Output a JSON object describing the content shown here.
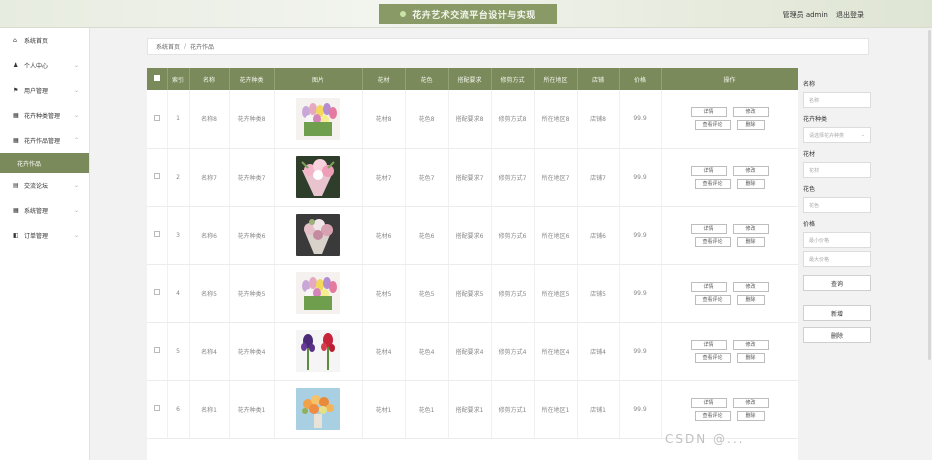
{
  "header": {
    "title": "花卉艺术交流平台设计与实现",
    "user_label": "管理员 admin",
    "logout_label": "退出登录"
  },
  "sidebar": {
    "items": [
      {
        "label": "系统首页",
        "icon": "home-icon",
        "glyph": "⌂",
        "arrow": ""
      },
      {
        "label": "个人中心",
        "icon": "user-icon",
        "glyph": "♟",
        "arrow": "⌄"
      },
      {
        "label": "用户管理",
        "icon": "flag-icon",
        "glyph": "⚑",
        "arrow": "⌄"
      },
      {
        "label": "花卉种类管理",
        "icon": "grid-icon",
        "glyph": "▦",
        "arrow": "⌄"
      },
      {
        "label": "花卉作品管理",
        "icon": "grid-icon",
        "glyph": "▦",
        "arrow": "⌃"
      }
    ],
    "active_sub": "花卉作品",
    "items_after": [
      {
        "label": "交流论坛",
        "icon": "forum-icon",
        "glyph": "▤",
        "arrow": "⌄"
      },
      {
        "label": "系统管理",
        "icon": "grid-icon",
        "glyph": "▦",
        "arrow": "⌄"
      },
      {
        "label": "订单管理",
        "icon": "cart-icon",
        "glyph": "◧",
        "arrow": "⌄"
      }
    ]
  },
  "breadcrumb": {
    "home": "系统首页",
    "separator": "/",
    "current": "花卉作品"
  },
  "table": {
    "headers": [
      "索引",
      "名称",
      "花卉种类",
      "图片",
      "花材",
      "花色",
      "搭配要求",
      "修剪方式",
      "所在地区",
      "店铺",
      "价格",
      "操作"
    ],
    "rows": [
      {
        "index": "1",
        "name": "名称8",
        "type": "花卉种类8",
        "material": "花材8",
        "color": "花色8",
        "req": "搭配要求8",
        "trim": "修剪方式8",
        "region": "所在地区8",
        "shop": "店铺8",
        "price": "99.9",
        "image": "tulip-bouquet-image"
      },
      {
        "index": "2",
        "name": "名称7",
        "type": "花卉种类7",
        "material": "花材7",
        "color": "花色7",
        "req": "搭配要求7",
        "trim": "修剪方式7",
        "region": "所在地区7",
        "shop": "店铺7",
        "price": "99.9",
        "image": "pink-bouquet-image"
      },
      {
        "index": "3",
        "name": "名称6",
        "type": "花卉种类6",
        "material": "花材6",
        "color": "花色6",
        "req": "搭配要求6",
        "trim": "修剪方式6",
        "region": "所在地区6",
        "shop": "店铺6",
        "price": "99.9",
        "image": "dark-bouquet-image"
      },
      {
        "index": "4",
        "name": "名称5",
        "type": "花卉种类5",
        "material": "花材5",
        "color": "花色5",
        "req": "搭配要求5",
        "trim": "修剪方式5",
        "region": "所在地区5",
        "shop": "店铺5",
        "price": "99.9",
        "image": "tulip-bouquet-image"
      },
      {
        "index": "5",
        "name": "名称4",
        "type": "花卉种类4",
        "material": "花材4",
        "color": "花色4",
        "req": "搭配要求4",
        "trim": "修剪方式4",
        "region": "所在地区4",
        "shop": "店铺4",
        "price": "99.9",
        "image": "purple-red-bouquet-image"
      },
      {
        "index": "6",
        "name": "名称1",
        "type": "花卉种类1",
        "material": "花材1",
        "color": "花色1",
        "req": "搭配要求1",
        "trim": "修剪方式1",
        "region": "所在地区1",
        "shop": "店铺1",
        "price": "99.9",
        "image": "orange-bouquet-image"
      }
    ],
    "ops": {
      "detail": "详情",
      "edit": "修改",
      "comment": "查看评论",
      "delete": "删除"
    }
  },
  "search_form": {
    "name_label": "名称",
    "name_placeholder": "名称",
    "type_label": "花卉种类",
    "type_placeholder": "请选择花卉种类",
    "material_label": "花材",
    "material_placeholder": "花材",
    "color_label": "花色",
    "color_placeholder": "花色",
    "price_label": "价格",
    "price_min_placeholder": "最小价格",
    "price_max_placeholder": "最大价格",
    "query_button": "查询",
    "add_button": "新增",
    "delete_button": "删除"
  },
  "watermark": "CSDN @...",
  "colors": {
    "accent": "#7b8a5a",
    "topbar_title_bg": "#8a9a67"
  }
}
